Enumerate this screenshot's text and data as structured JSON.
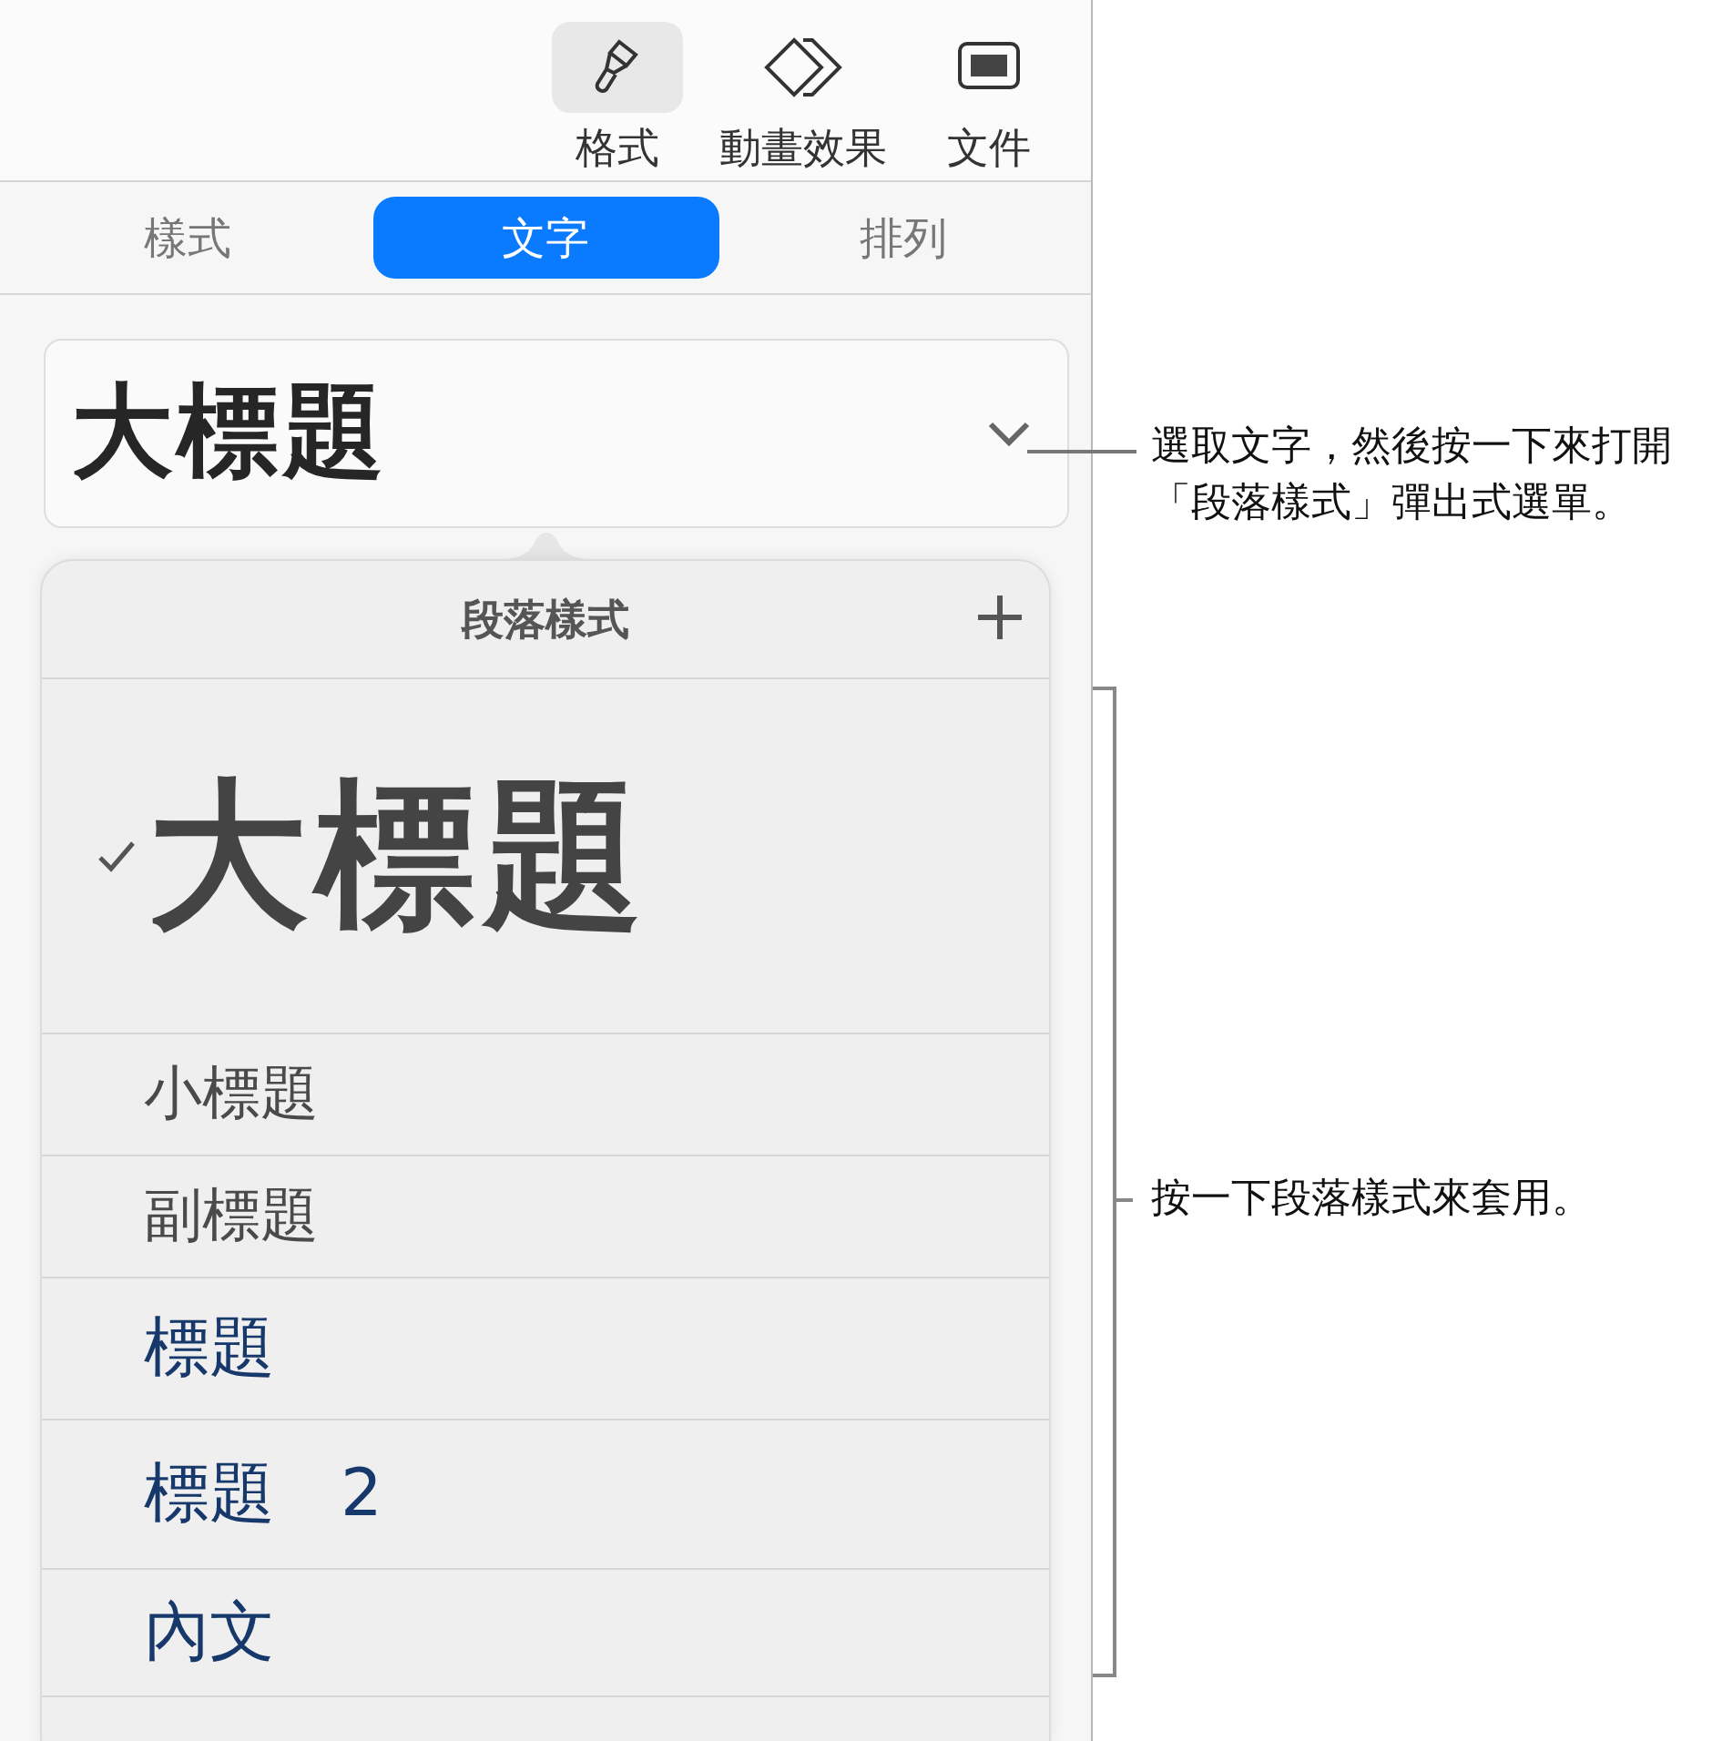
{
  "toolbar": [
    {
      "kind": "format",
      "label": "格式",
      "selected": true
    },
    {
      "kind": "animate",
      "label": "動畫效果",
      "selected": false
    },
    {
      "kind": "document",
      "label": "文件",
      "selected": false
    }
  ],
  "tabs": [
    {
      "label": "樣式",
      "selected": false
    },
    {
      "label": "文字",
      "selected": true
    },
    {
      "label": "排列",
      "selected": false
    }
  ],
  "style_field": {
    "value": "大標題"
  },
  "popover": {
    "title": "段落樣式",
    "styles": [
      {
        "kind": "title",
        "label": "大標題",
        "selected": true
      },
      {
        "kind": "subtitle",
        "label": "小標題",
        "selected": false
      },
      {
        "kind": "subtitle",
        "label": "副標題",
        "selected": false
      },
      {
        "kind": "heading",
        "label": "標題",
        "selected": false
      },
      {
        "kind": "heading2",
        "label": "標題　2",
        "selected": false
      },
      {
        "kind": "body",
        "label": "內文",
        "selected": false
      }
    ]
  },
  "annotations": [
    {
      "kind": "pointer",
      "text": "選取文字，然後按一下來打開「段落樣式」彈出式選單。"
    },
    {
      "kind": "bracket",
      "text": "按一下段落樣式來套用。"
    }
  ]
}
